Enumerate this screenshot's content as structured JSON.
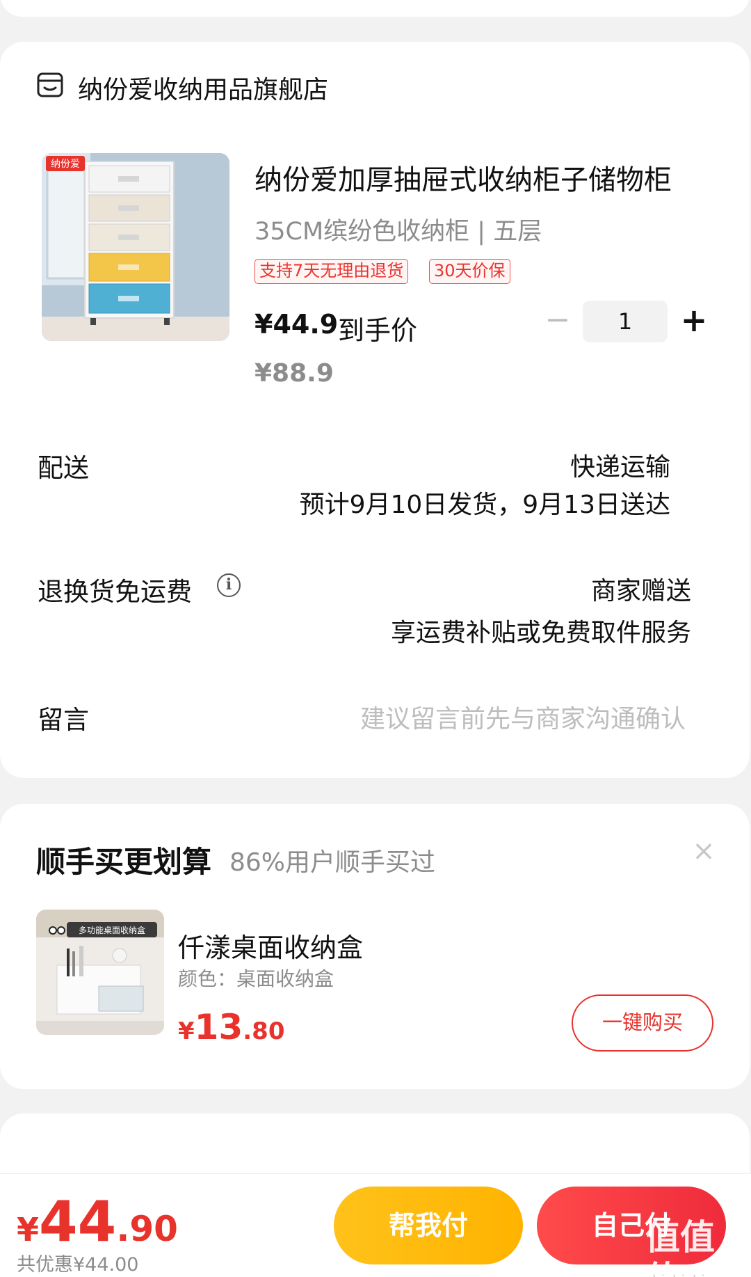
{
  "shop": {
    "name": "纳份爱收纳用品旗舰店",
    "icon": "shop-icon"
  },
  "product": {
    "image_brand": "纳份爱",
    "title": "纳份爱加厚抽屉式收纳柜子储物柜",
    "spec": "35CM缤纷色收纳柜 | 五层",
    "tags": [
      "支持7天无理由退货",
      "30天价保"
    ],
    "price": "¥44.9",
    "price_label": "到手价",
    "original_price": "¥88.9",
    "quantity": "1",
    "qty_minus": "−",
    "qty_plus": "+"
  },
  "delivery": {
    "label": "配送",
    "method": "快递运输",
    "estimate": "预计9月10日发货，9月13日送达"
  },
  "return_shipping": {
    "label": "退换货免运费",
    "info_icon": "i",
    "value": "商家赠送",
    "detail": "享运费补贴或免费取件服务"
  },
  "message": {
    "label": "留言",
    "placeholder": "建议留言前先与商家沟通确认"
  },
  "upsell": {
    "title": "顺手买更划算",
    "subtitle": "86%用户顺手买过",
    "close": "×",
    "image_caption": "多功能桌面收纳盒",
    "item_name": "仟漾桌面收纳盒",
    "item_spec": "颜色：桌面收纳盒",
    "price_currency": "¥",
    "price_int": "13",
    "price_dec": ".80",
    "buy_button": "一键购买"
  },
  "footer": {
    "currency": "¥",
    "total_int": "44",
    "total_dec": ".90",
    "discount": "共优惠¥44.00",
    "help_pay": "帮我付",
    "self_pay": "自己付",
    "watermark": "值值值",
    "watermark_url": "zhizhizhi.com"
  },
  "colors": {
    "accent": "#e8332d",
    "help_button": "#ffb300",
    "self_button": "#ef2b3b",
    "muted_text": "#8c8c8c"
  }
}
